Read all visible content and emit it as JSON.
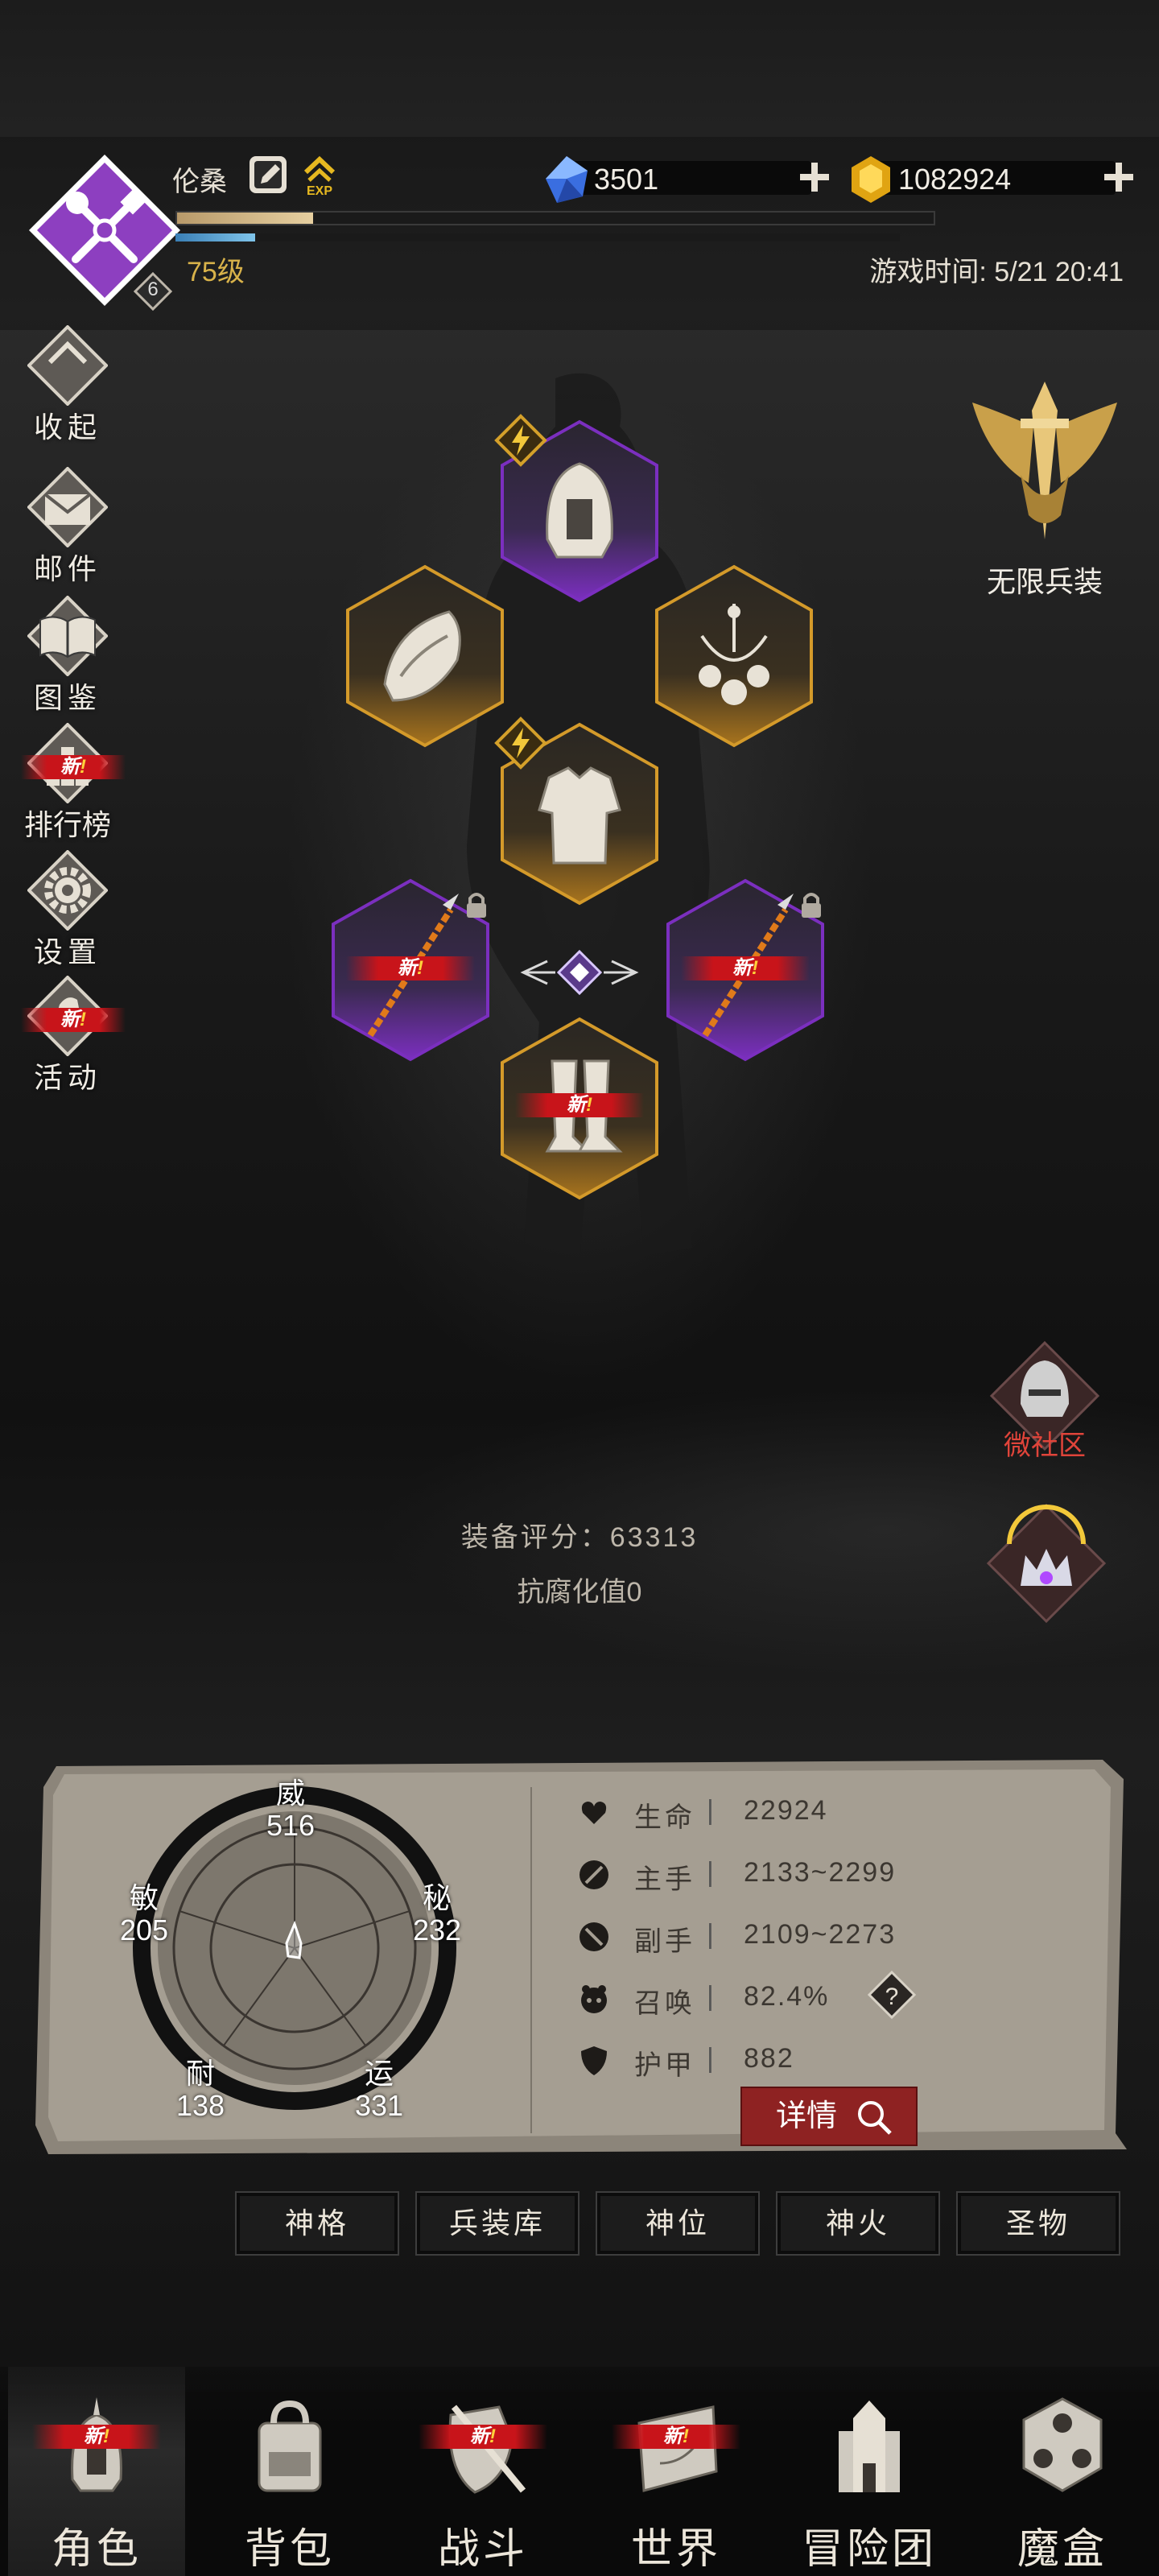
{
  "player": {
    "name": "伦桑",
    "level_badge": "6",
    "level_text": "75级",
    "exp_label": "EXP",
    "exp_progress": 0.18,
    "mana_progress": 0.11
  },
  "currency": {
    "diamond": "3501",
    "gold": "1082924"
  },
  "game_time": "游戏时间: 5/21  20:41",
  "side_menu": [
    {
      "label": "收起",
      "new": false
    },
    {
      "label": "邮件",
      "new": false
    },
    {
      "label": "图鉴",
      "new": false
    },
    {
      "label": "排行榜",
      "new": true
    },
    {
      "label": "设置",
      "new": false
    },
    {
      "label": "活动",
      "new": true
    }
  ],
  "new_tag": {
    "text": "新",
    "mark": "!"
  },
  "infinite_arms_label": "无限兵装",
  "equipment": {
    "score": "装备评分：63313",
    "anti_corruption": "抗腐化值0",
    "slots": [
      {
        "slot": "head",
        "rarity": "purple",
        "icon": "helmet-icon",
        "new": false
      },
      {
        "slot": "shoulder",
        "rarity": "gold",
        "icon": "pauldron-icon",
        "new": false
      },
      {
        "slot": "accessory",
        "rarity": "gold",
        "icon": "necklace-icon",
        "new": false
      },
      {
        "slot": "chest",
        "rarity": "gold",
        "icon": "armor-icon",
        "new": false
      },
      {
        "slot": "main-hand",
        "rarity": "purple",
        "icon": "spear-icon",
        "new": true
      },
      {
        "slot": "off-hand",
        "rarity": "purple",
        "icon": "spear-icon",
        "new": true
      },
      {
        "slot": "legs",
        "rarity": "gold",
        "icon": "greaves-icon",
        "new": true
      }
    ]
  },
  "community_label": "微社区",
  "attributes": {
    "wei": {
      "name": "威",
      "value": "516"
    },
    "mi": {
      "name": "秘",
      "value": "232"
    },
    "min": {
      "name": "敏",
      "value": "205"
    },
    "nai": {
      "name": "耐",
      "value": "138"
    },
    "yun": {
      "name": "运",
      "value": "331"
    }
  },
  "stats": [
    {
      "key": "生命",
      "value": "22924",
      "icon": "heart-icon"
    },
    {
      "key": "主手",
      "value": "2133~2299",
      "icon": "sword-icon"
    },
    {
      "key": "副手",
      "value": "2109~2273",
      "icon": "offhand-icon"
    },
    {
      "key": "召唤",
      "value": "82.4%",
      "icon": "summon-icon"
    },
    {
      "key": "护甲",
      "value": "882",
      "icon": "shield-icon"
    }
  ],
  "detail_button": "详情",
  "tabs": [
    "神格",
    "兵装库",
    "神位",
    "神火",
    "圣物"
  ],
  "bottom_nav": [
    {
      "label": "角色",
      "icon": "helmet-icon",
      "new": true,
      "active": true
    },
    {
      "label": "背包",
      "icon": "backpack-icon",
      "new": false,
      "active": false
    },
    {
      "label": "战斗",
      "icon": "shield-sword-icon",
      "new": true,
      "active": false
    },
    {
      "label": "世界",
      "icon": "map-scroll-icon",
      "new": true,
      "active": false
    },
    {
      "label": "冒险团",
      "icon": "castle-icon",
      "new": false,
      "active": false
    },
    {
      "label": "魔盒",
      "icon": "cube-icon",
      "new": false,
      "active": false
    }
  ],
  "colors": {
    "purple_rarity": "#7b2fbf",
    "gold_rarity": "#d49a2a",
    "new_red": "#c8141a",
    "level_gold": "#d8b24a"
  }
}
